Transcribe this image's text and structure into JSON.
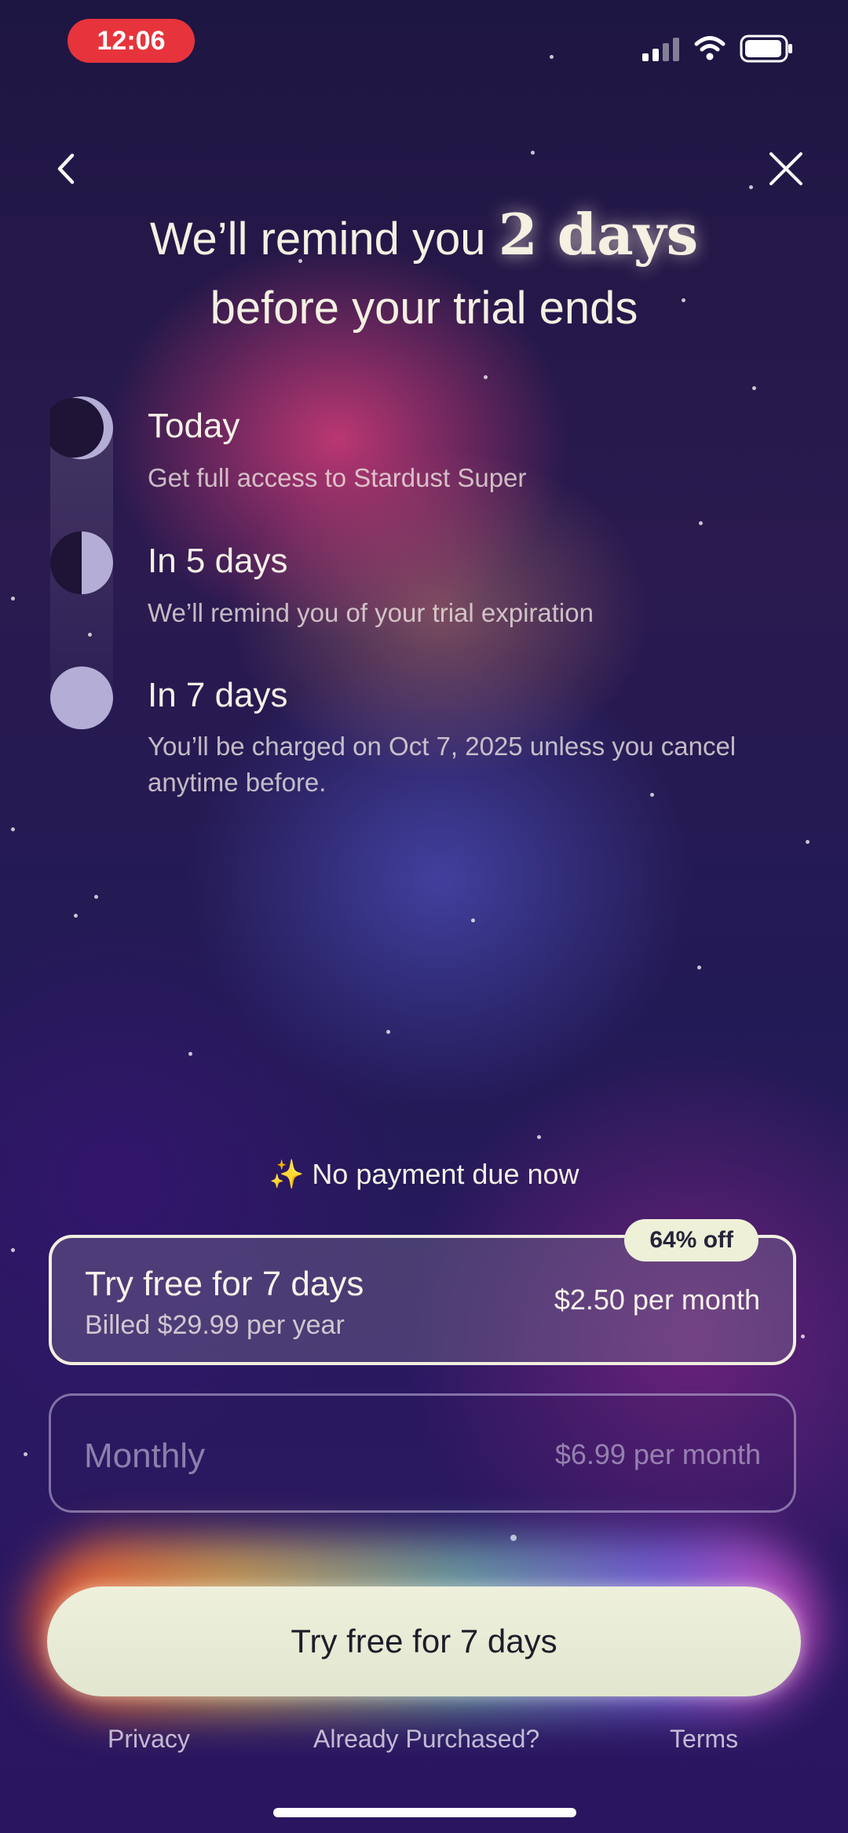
{
  "status_bar": {
    "time": "12:06"
  },
  "headline": {
    "line1_prefix": "We’ll remind you",
    "line1_emphasis": "2 days",
    "line2": "before your trial ends"
  },
  "timeline": [
    {
      "title": "Today",
      "description": "Get full access to Stardust Super"
    },
    {
      "title": "In 5 days",
      "description": "We’ll remind you of your trial expiration"
    },
    {
      "title": "In 7 days",
      "description": "You’ll be charged on Oct 7, 2025 unless you cancel anytime before."
    }
  ],
  "no_payment": {
    "icon": "sparkles-icon",
    "text": "No payment due now"
  },
  "plans": {
    "yearly": {
      "name": "Try free for 7 days",
      "billed": "Billed $29.99 per year",
      "price": "$2.50 per month",
      "badge": "64% off",
      "selected": true
    },
    "monthly": {
      "name": "Monthly",
      "price": "$6.99 per month",
      "selected": false
    }
  },
  "cta": {
    "label": "Try free for 7 days"
  },
  "footer": {
    "privacy": "Privacy",
    "restore": "Already Purchased?",
    "terms": "Terms"
  },
  "colors": {
    "accent": "#eef0dc",
    "status_pill": "#e7343c",
    "background": "#221a55"
  }
}
